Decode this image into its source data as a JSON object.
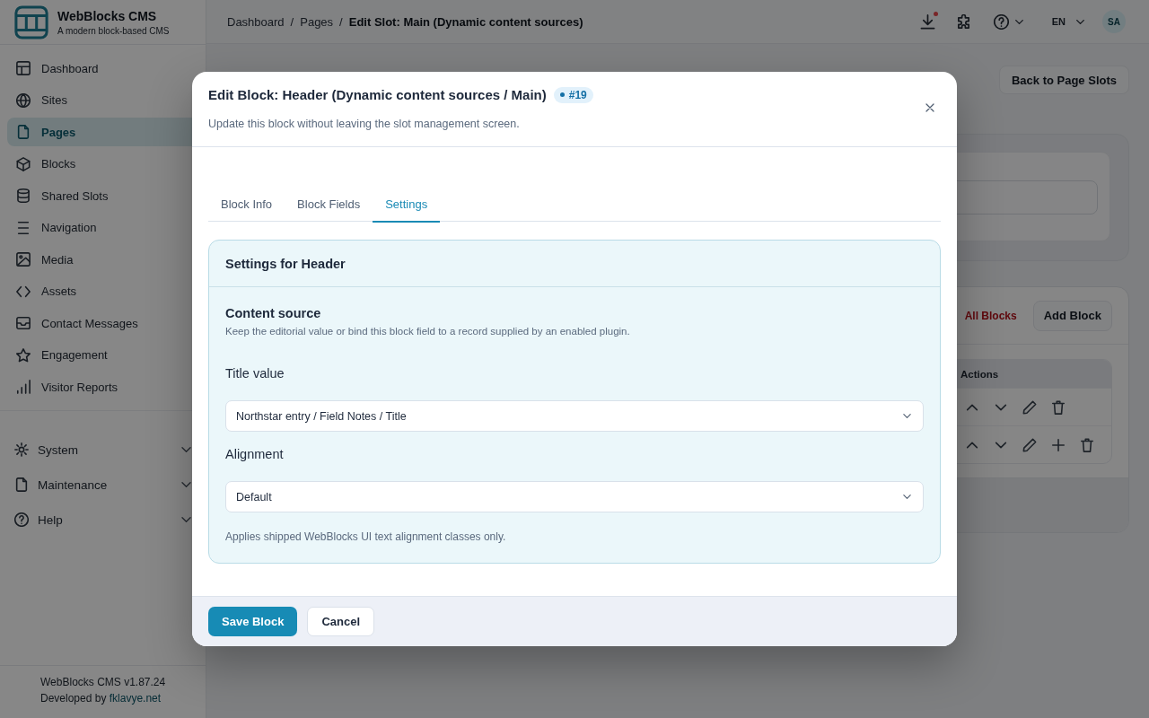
{
  "sidebar": {
    "brand": {
      "title": "WebBlocks CMS",
      "subtitle": "A modern block-based CMS"
    },
    "items": [
      {
        "label": "Dashboard",
        "selected": false
      },
      {
        "label": "Sites",
        "selected": false
      },
      {
        "label": "Pages",
        "selected": true
      },
      {
        "label": "Blocks",
        "selected": false
      },
      {
        "label": "Shared Slots",
        "selected": false
      },
      {
        "label": "Navigation",
        "selected": false
      },
      {
        "label": "Media",
        "selected": false
      },
      {
        "label": "Assets",
        "selected": false
      },
      {
        "label": "Contact Messages",
        "selected": false
      },
      {
        "label": "Engagement",
        "selected": false
      },
      {
        "label": "Visitor Reports",
        "selected": false
      }
    ],
    "groups": [
      {
        "label": "System",
        "expanded": false
      },
      {
        "label": "Maintenance",
        "expanded": false
      },
      {
        "label": "Help",
        "expanded": false
      }
    ],
    "footer": {
      "version": "WebBlocks CMS v1.87.24",
      "credit": "Developed by",
      "link": "fklavye.net"
    }
  },
  "topbar": {
    "breadcrumb": {
      "separator": "/",
      "items": [
        "Dashboard",
        "Pages",
        "Edit Slot: Main (Dynamic content sources)"
      ]
    },
    "downloads_unread": true,
    "language": "EN",
    "avatar": "SA"
  },
  "page": {
    "back_button": "Back to Page Slots",
    "blocks": {
      "all_blocks_link": "All Blocks",
      "add_button": "Add Block",
      "table": {
        "columns": [
          "Actions"
        ],
        "rows": [
          {
            "can_add": false
          },
          {
            "can_add": true
          }
        ]
      }
    }
  },
  "modal": {
    "title": "Edit Block: Header (Dynamic content sources / Main)",
    "badge": "#19",
    "subtitle": "Update this block without leaving the slot management screen.",
    "tabs": [
      {
        "label": "Block Info",
        "selected": false
      },
      {
        "label": "Block Fields",
        "selected": false
      },
      {
        "label": "Settings",
        "selected": true
      }
    ],
    "panel": {
      "title": "Settings for Header",
      "section": {
        "title": "Content source",
        "description": "Keep the editorial value or bind this block field to a record supplied by an enabled plugin."
      },
      "fields": [
        {
          "label": "Title value",
          "value": "Northstar entry / Field Notes / Title"
        },
        {
          "label": "Alignment",
          "value": "Default"
        }
      ],
      "help": "Applies shipped WebBlocks UI text alignment classes only."
    },
    "buttons": {
      "save": "Save Block",
      "cancel": "Cancel"
    }
  }
}
